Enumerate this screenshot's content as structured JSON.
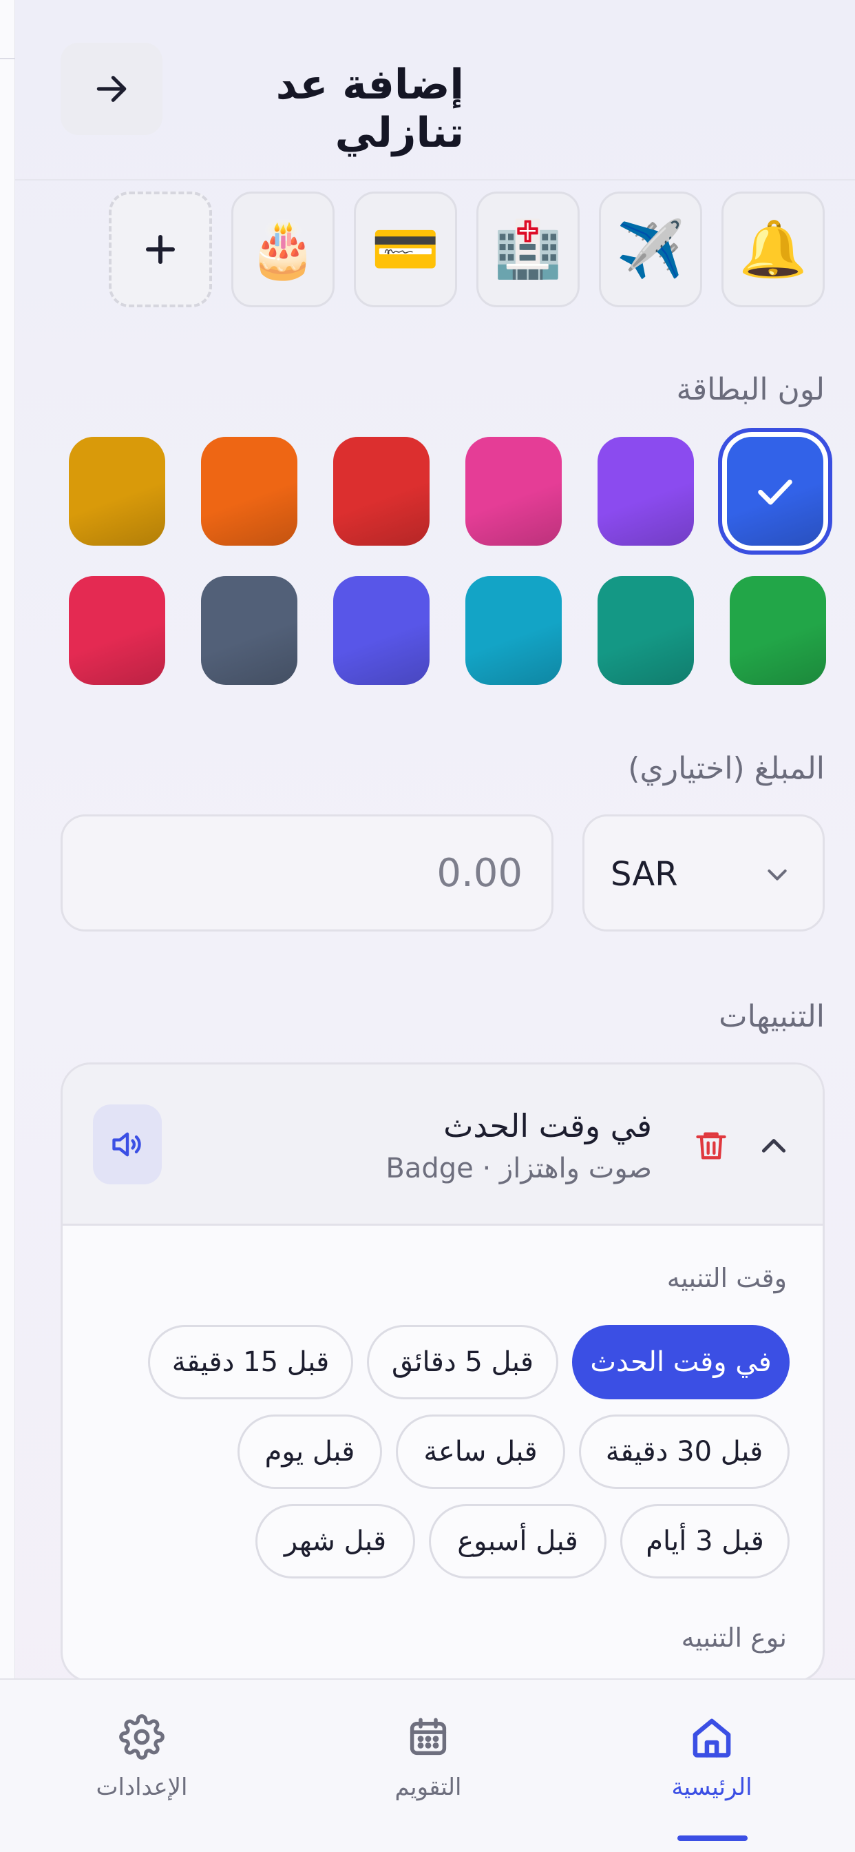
{
  "header": {
    "title": "إضافة عد تنازلي",
    "back_icon": "arrow-right-icon"
  },
  "icons": [
    {
      "name": "bell-icon",
      "glyph": "🔔"
    },
    {
      "name": "airplane-icon",
      "glyph": "✈️"
    },
    {
      "name": "hospital-icon",
      "glyph": "🏥"
    },
    {
      "name": "credit-card-icon",
      "glyph": "💳"
    },
    {
      "name": "birthday-cake-icon",
      "glyph": "🎂"
    },
    {
      "name": "plus-icon",
      "glyph": "+"
    }
  ],
  "card_color": {
    "label": "لون البطاقة",
    "selected_index": 0,
    "colors": [
      "#3262e8",
      "#8b4bef",
      "#e53d96",
      "#dc2f2f",
      "#ee6614",
      "#d99a0a",
      "#22a648",
      "#149885",
      "#13a4c6",
      "#5856e8",
      "#526078",
      "#e42a52"
    ]
  },
  "amount": {
    "label": "المبلغ (اختياري)",
    "currency": "SAR",
    "placeholder": "0.00"
  },
  "alerts": {
    "label": "التنبيهات",
    "item": {
      "title": "في وقت الحدث",
      "subtitle": "صوت واهتزاز · Badge"
    },
    "time_label": "وقت التنبيه",
    "time_options": [
      "في وقت الحدث",
      "قبل 5 دقائق",
      "قبل 15 دقيقة",
      "قبل 30 دقيقة",
      "قبل ساعة",
      "قبل يوم",
      "قبل 3 أيام",
      "قبل أسبوع",
      "قبل شهر"
    ],
    "selected_time": 0,
    "type_label": "نوع التنبيه"
  },
  "nav": {
    "home": "الرئيسية",
    "calendar": "التقويم",
    "settings": "الإعدادات"
  },
  "colors": {
    "accent": "#3b4fe4",
    "danger": "#e0383e"
  }
}
